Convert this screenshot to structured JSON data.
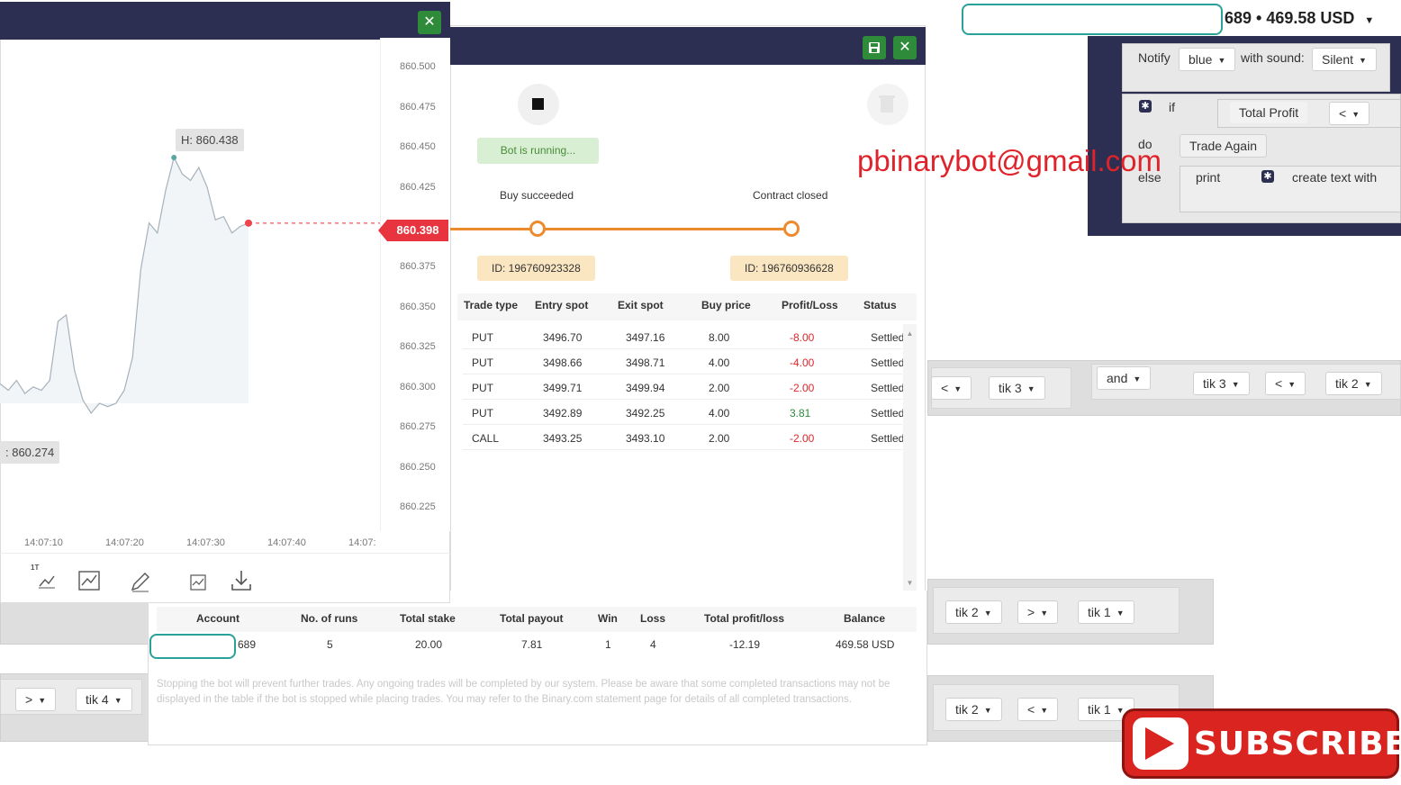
{
  "account": {
    "input_value": "",
    "summary": "689 • 469.58 USD"
  },
  "watermark": {
    "email": "pbinarybot@gmail.com"
  },
  "blockly": {
    "notify_label": "Notify",
    "notify_color": "blue",
    "with_sound_label": "with sound:",
    "sound_value": "Silent",
    "if_label": "if",
    "total_profit_label": "Total Profit",
    "compare_op": "<",
    "do_label": "do",
    "trade_again_label": "Trade Again",
    "else_label": "else",
    "print_label": "print",
    "create_text_label": "create text with",
    "strip1": [
      {
        "label": "<"
      },
      {
        "label": "tik 3"
      },
      {
        "label": "and"
      },
      {
        "label": "tik 3"
      },
      {
        "label": "<"
      },
      {
        "label": "tik 2"
      }
    ],
    "strip2": [
      {
        "label": "tik 2"
      },
      {
        "label": ">"
      },
      {
        "label": "tik 1"
      }
    ],
    "strip3_left": [
      {
        "label": ">"
      },
      {
        "label": "tik 4"
      }
    ],
    "strip3_right": [
      {
        "label": "tik 2"
      },
      {
        "label": "<"
      },
      {
        "label": "tik 1"
      }
    ]
  },
  "chart": {
    "close_icon": "close-icon",
    "price_ticks": [
      "860.500",
      "860.475",
      "860.450",
      "860.425",
      "860.398",
      "860.375",
      "860.350",
      "860.325",
      "860.300",
      "860.275",
      "860.250",
      "860.225"
    ],
    "time_ticks": [
      "14:07:10",
      "14:07:20",
      "14:07:30",
      "14:07:40",
      "14:07:"
    ],
    "high_label": "H: 860.438",
    "low_label": ": 860.274",
    "current_price": "860.398",
    "timeframe_label": "1T",
    "chart_data": {
      "type": "line",
      "xlabel": "",
      "ylabel": "",
      "ylim": [
        860.21,
        860.51
      ],
      "x_ticks": [
        "14:07:10",
        "14:07:20",
        "14:07:30",
        "14:07:40"
      ],
      "series": [
        {
          "values": [
            860.3,
            860.296,
            860.302,
            860.294,
            860.298,
            860.296,
            860.302,
            860.338,
            860.342,
            860.308,
            860.29,
            860.282,
            860.288,
            860.286,
            860.288,
            860.296,
            860.316,
            860.37,
            860.398,
            860.392,
            860.418,
            860.438,
            860.428,
            860.424,
            860.432,
            860.42,
            860.4,
            860.402,
            860.392,
            860.396,
            860.398
          ]
        }
      ]
    }
  },
  "run": {
    "save_icon": "save-icon",
    "close_icon": "close-icon",
    "status": "Bot is running...",
    "step1": "Buy succeeded",
    "step2": "Contract closed",
    "id1": "ID: 196760923328",
    "id2": "ID: 196760936628",
    "columns": [
      "Trade type",
      "Entry spot",
      "Exit spot",
      "Buy price",
      "Profit/Loss",
      "Status"
    ],
    "rows": [
      {
        "type": "PUT",
        "entry": "3496.70",
        "exit": "3497.16",
        "buy": "8.00",
        "pl": "-8.00",
        "status": "Settled"
      },
      {
        "type": "PUT",
        "entry": "3498.66",
        "exit": "3498.71",
        "buy": "4.00",
        "pl": "-4.00",
        "status": "Settled"
      },
      {
        "type": "PUT",
        "entry": "3499.71",
        "exit": "3499.94",
        "buy": "2.00",
        "pl": "-2.00",
        "status": "Settled"
      },
      {
        "type": "PUT",
        "entry": "3492.89",
        "exit": "3492.25",
        "buy": "4.00",
        "pl": "3.81",
        "status": "Settled"
      },
      {
        "type": "CALL",
        "entry": "3493.25",
        "exit": "3493.10",
        "buy": "2.00",
        "pl": "-2.00",
        "status": "Settled"
      }
    ],
    "summary_headers": [
      "Account",
      "No. of runs",
      "Total stake",
      "Total payout",
      "Win",
      "Loss",
      "Total profit/loss",
      "Balance"
    ],
    "summary": {
      "account": "689",
      "runs": "5",
      "stake": "20.00",
      "payout": "7.81",
      "win": "1",
      "loss": "4",
      "profit": "-12.19",
      "balance": "469.58 USD"
    },
    "disclaimer": "Stopping the bot will prevent further trades. Any ongoing trades will be completed by our system. Please be aware that some completed transactions may not be displayed in the table if the bot is stopped while placing trades. You may refer to the Binary.com statement page for details of all completed transactions."
  },
  "subscribe": {
    "label": "SUBSCRIBE"
  },
  "colors": {
    "header": "#2c2f52",
    "accent_green": "#2e8b3a",
    "accent_orange": "#ee8a2e",
    "loss_red": "#e0262b",
    "price_red": "#e8343f"
  }
}
